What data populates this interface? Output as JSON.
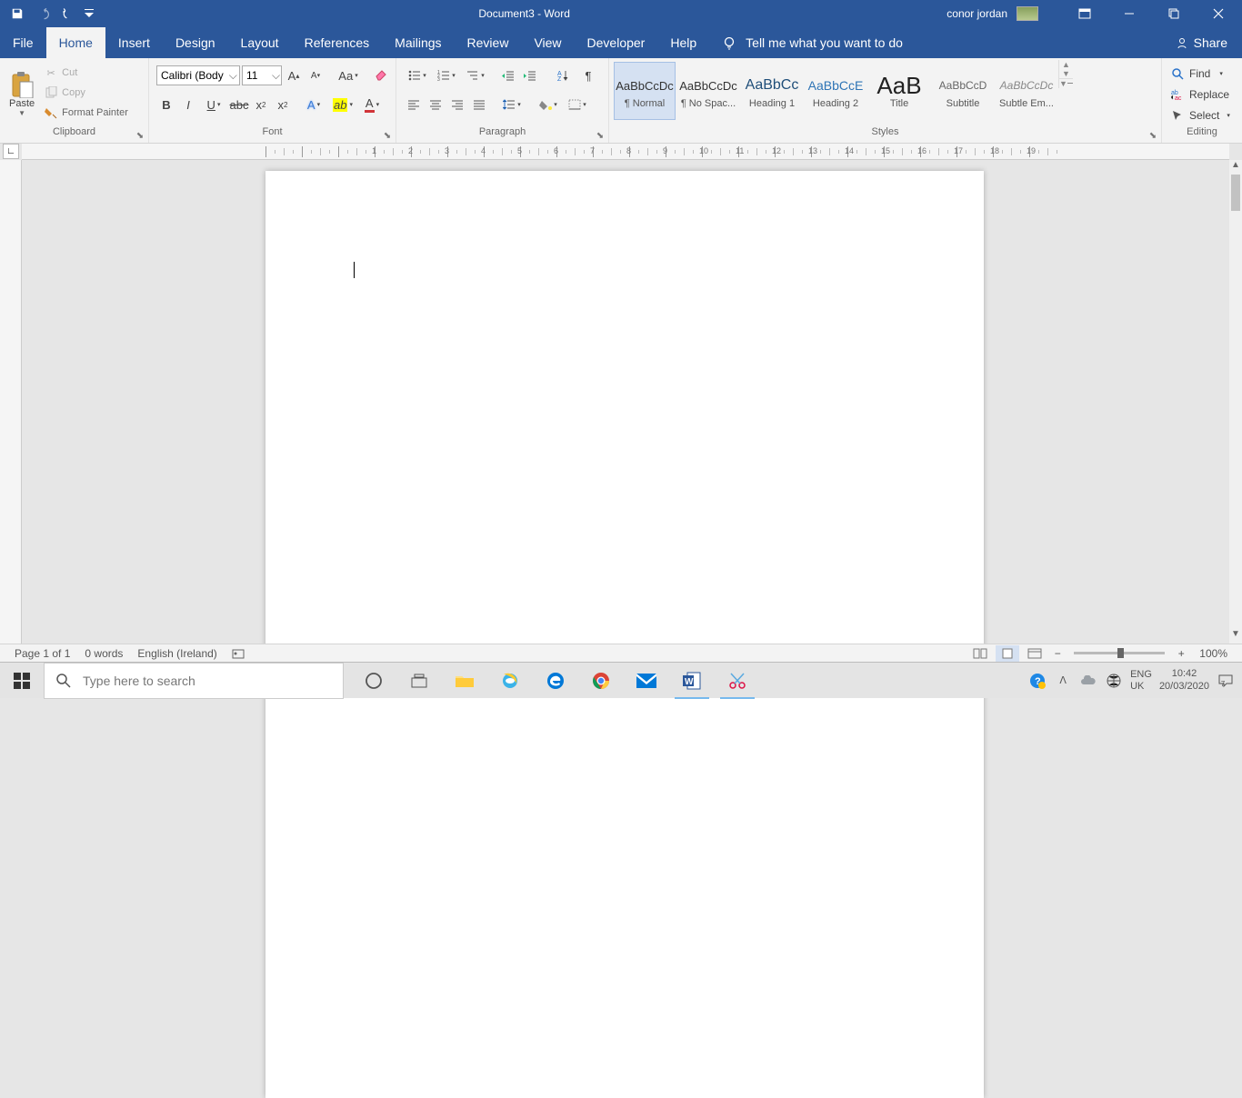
{
  "titlebar": {
    "document_name": "Document3",
    "app_suffix": "  -  Word",
    "user_name": "conor jordan"
  },
  "tabs": {
    "file": "File",
    "home": "Home",
    "insert": "Insert",
    "design": "Design",
    "layout": "Layout",
    "references": "References",
    "mailings": "Mailings",
    "review": "Review",
    "view": "View",
    "developer": "Developer",
    "help": "Help",
    "tell_me": "Tell me what you want to do",
    "share": "Share"
  },
  "ribbon": {
    "clipboard": {
      "paste": "Paste",
      "cut": "Cut",
      "copy": "Copy",
      "format_painter": "Format Painter",
      "label": "Clipboard"
    },
    "font": {
      "name": "Calibri (Body",
      "size": "11",
      "label": "Font"
    },
    "paragraph": {
      "label": "Paragraph"
    },
    "styles": {
      "label": "Styles",
      "items": [
        {
          "preview": "AaBbCcDc",
          "name": "¶ Normal",
          "size": "13px",
          "color": "#333"
        },
        {
          "preview": "AaBbCcDc",
          "name": "¶ No Spac...",
          "size": "13px",
          "color": "#333"
        },
        {
          "preview": "AaBbCc",
          "name": "Heading 1",
          "size": "16px",
          "color": "#1f4e79"
        },
        {
          "preview": "AaBbCcE",
          "name": "Heading 2",
          "size": "14px",
          "color": "#2e74b5"
        },
        {
          "preview": "AaB",
          "name": "Title",
          "size": "26px",
          "color": "#222"
        },
        {
          "preview": "AaBbCcD",
          "name": "Subtitle",
          "size": "12px",
          "color": "#666"
        },
        {
          "preview": "AaBbCcDc",
          "name": "Subtle Em...",
          "size": "12px",
          "color": "#888",
          "italic": true
        }
      ]
    },
    "editing": {
      "find": "Find",
      "replace": "Replace",
      "select": "Select",
      "label": "Editing"
    }
  },
  "statusbar": {
    "page": "Page 1 of 1",
    "words": "0 words",
    "language": "English (Ireland)",
    "zoom": "100%"
  },
  "taskbar": {
    "search_placeholder": "Type here to search",
    "lang1": "ENG",
    "lang2": "UK",
    "time": "10:42",
    "date": "20/03/2020"
  }
}
